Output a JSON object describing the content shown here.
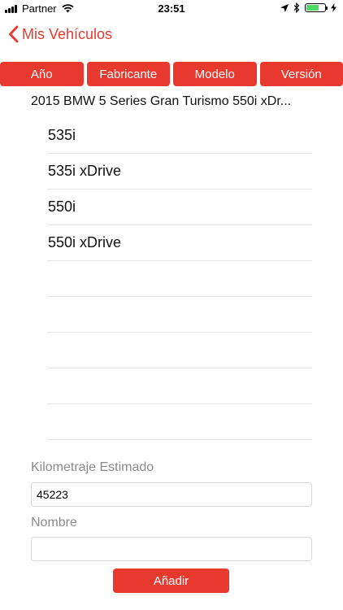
{
  "status_bar": {
    "carrier": "Partner",
    "time": "23:51",
    "battery_level": 0.7,
    "colors": {
      "battery_fill": "#4cd964"
    }
  },
  "nav": {
    "back_label": "Mis Vehículos"
  },
  "tabs": [
    {
      "label": "Año"
    },
    {
      "label": "Fabricante"
    },
    {
      "label": "Modelo"
    },
    {
      "label": "Versión"
    }
  ],
  "vehicle_title": "2015 BMW 5 Series Gran Turismo 550i xDr...",
  "versions": [
    "535i",
    "535i xDrive",
    "550i",
    "550i xDrive",
    "",
    "",
    "",
    "",
    ""
  ],
  "form": {
    "mileage_label": "Kilometraje Estimado",
    "mileage_value": "45223",
    "name_label": "Nombre",
    "name_value": ""
  },
  "add_button": "Añadir",
  "colors": {
    "accent": "#e8392f"
  }
}
